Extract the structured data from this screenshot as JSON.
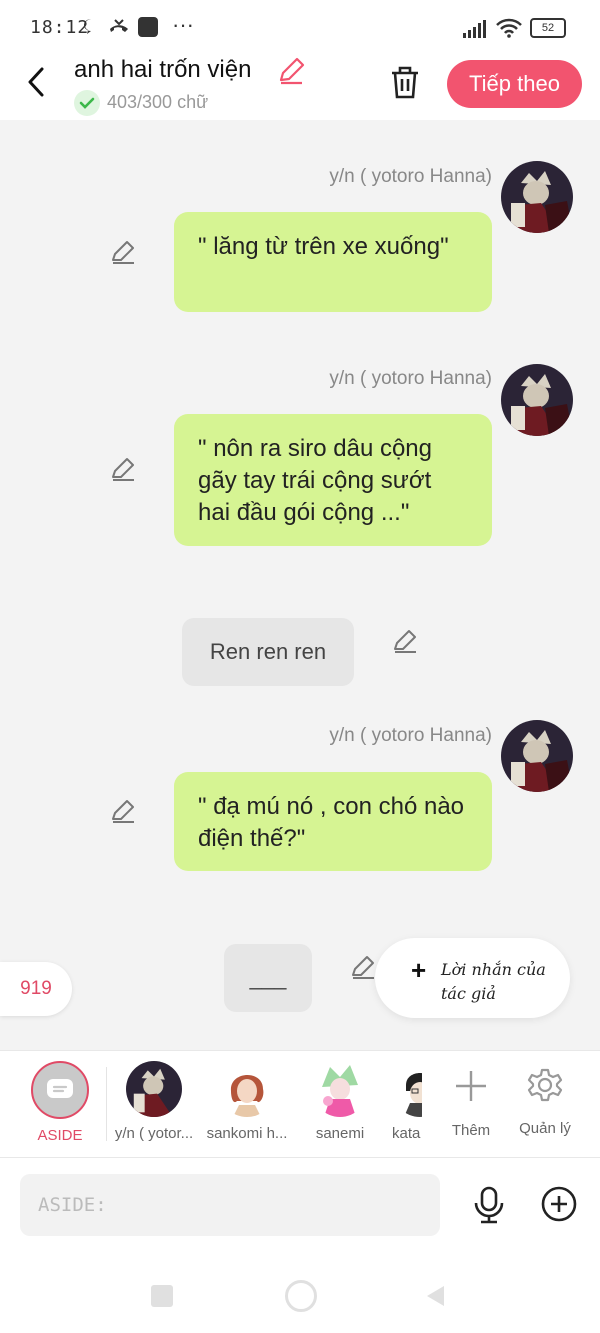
{
  "status": {
    "time": "18:12",
    "battery": "52"
  },
  "header": {
    "title": "anh hai trốn viện",
    "word_count": "403/300 chữ",
    "next_label": "Tiếp theo"
  },
  "messages": [
    {
      "type": "character",
      "sender": "y/n ( yotoro Hanna)",
      "text": "\" lăng từ trên xe xuống\""
    },
    {
      "type": "character",
      "sender": "y/n ( yotoro Hanna)",
      "text": "\" nôn ra siro dâu cộng gãy tay trái cộng sướt hai đầu gói cộng ...\""
    },
    {
      "type": "aside",
      "text": "Ren ren ren"
    },
    {
      "type": "character",
      "sender": "y/n ( yotoro Hanna)",
      "text": "\" đạ mú nó , con chó nào điện thế?\""
    },
    {
      "type": "aside",
      "text": "___"
    }
  ],
  "floating": {
    "count": "919",
    "author_note": "Lời nhắn của tác giả"
  },
  "characters": [
    {
      "label": "ASIDE"
    },
    {
      "label": "y/n ( yotor..."
    },
    {
      "label": "sankomi h..."
    },
    {
      "label": "sanemi"
    },
    {
      "label": "kata"
    }
  ],
  "actions": {
    "add_label": "Thêm",
    "manage_label": "Quản lý"
  },
  "composer": {
    "placeholder": "ASIDE:"
  },
  "colors": {
    "accent": "#f2546f",
    "bubble": "#d6f493",
    "chat_bg": "#f3f3f3",
    "aside_bubble": "#e6e6e6"
  }
}
